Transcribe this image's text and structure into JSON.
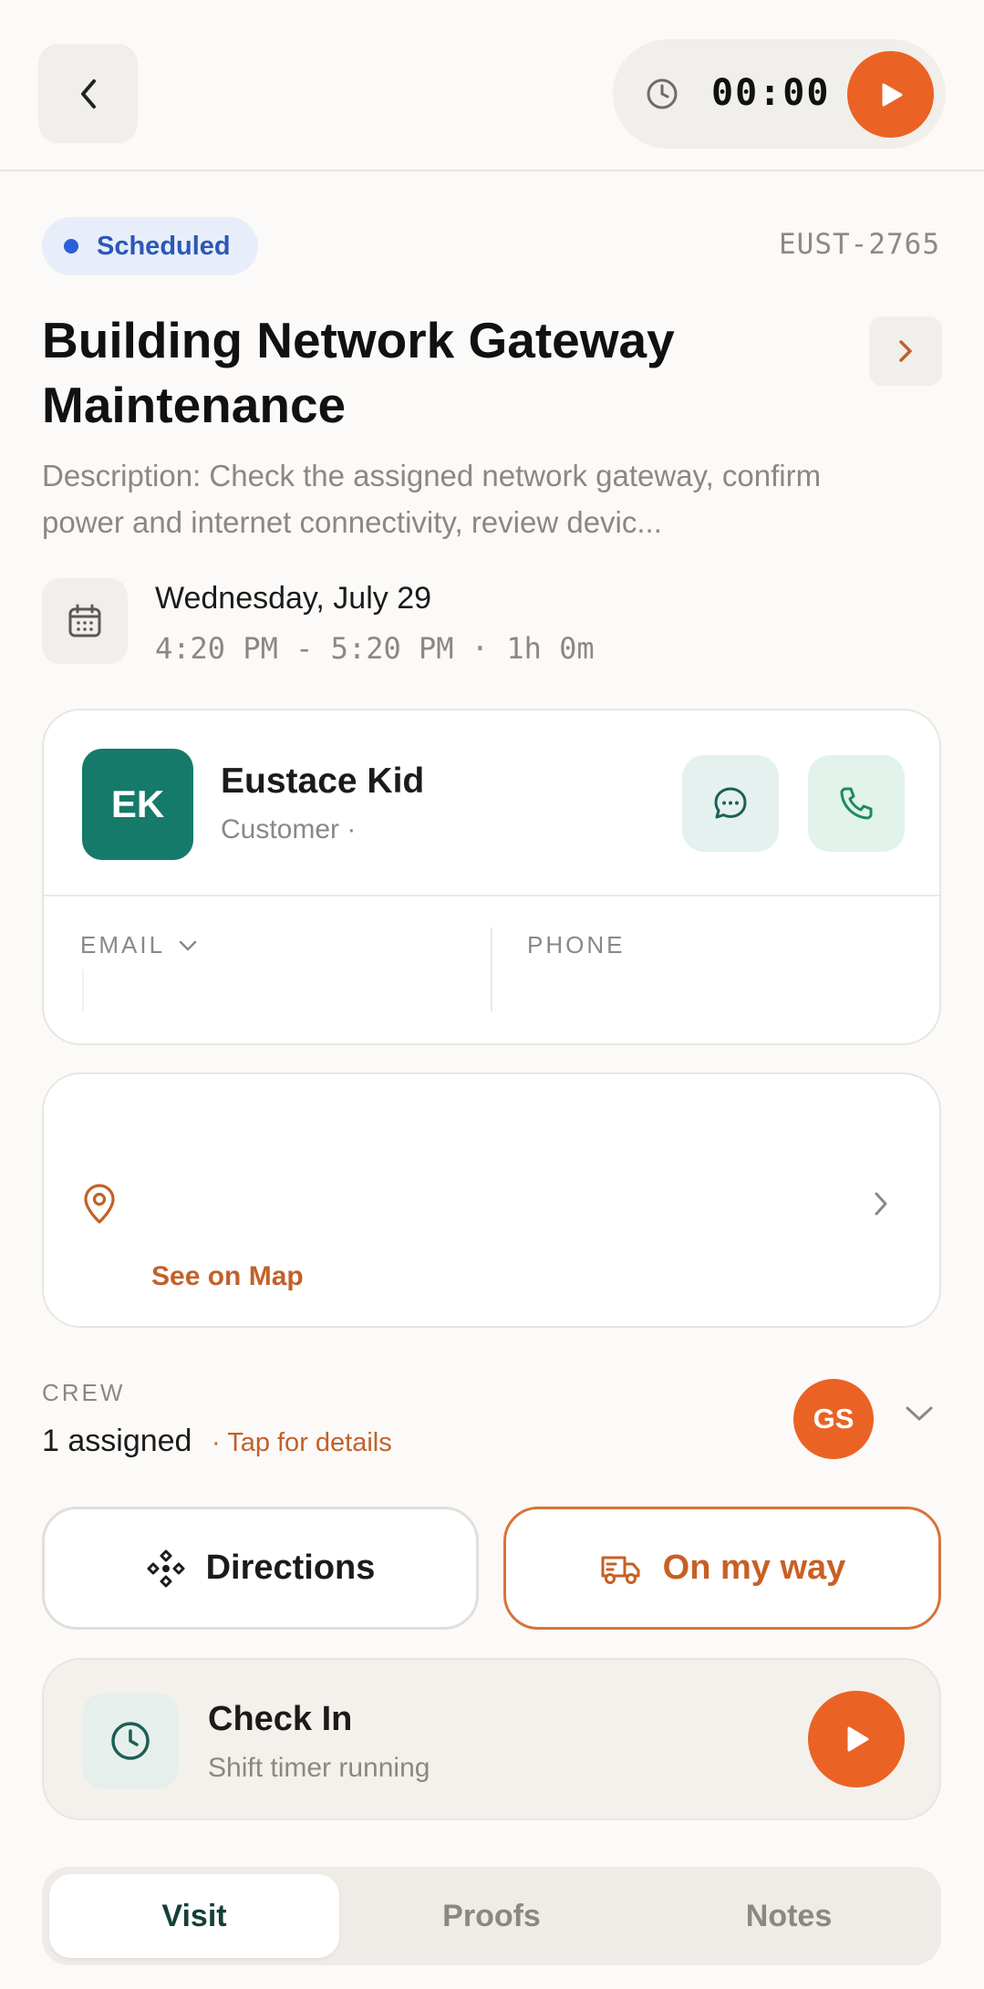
{
  "header": {
    "timer": "00:00"
  },
  "job": {
    "status": "Scheduled",
    "id": "EUST-2765",
    "title": "Building Network Gateway Maintenance",
    "description": "Description: Check the assigned network gateway, confirm power and internet connectivity, review devic...",
    "date": "Wednesday, July 29",
    "time": "4:20 PM - 5:20 PM · 1h 0m"
  },
  "customer": {
    "initials": "EK",
    "name": "Eustace Kid",
    "role": "Customer ·",
    "email_label": "EMAIL",
    "phone_label": "PHONE"
  },
  "location": {
    "map_link": "See on Map"
  },
  "crew": {
    "label": "CREW",
    "count": "1 assigned",
    "details_link": "· Tap for details",
    "member_initials": "GS"
  },
  "actions": {
    "directions": "Directions",
    "on_my_way": "On my way"
  },
  "checkin": {
    "title": "Check In",
    "subtitle": "Shift timer running"
  },
  "tabs": [
    {
      "label": "Visit",
      "active": true
    },
    {
      "label": "Proofs",
      "active": false
    },
    {
      "label": "Notes",
      "active": false
    }
  ],
  "colors": {
    "accent": "#ea6324",
    "status_blue": "#2b61d6",
    "avatar_teal": "#157a6a"
  }
}
